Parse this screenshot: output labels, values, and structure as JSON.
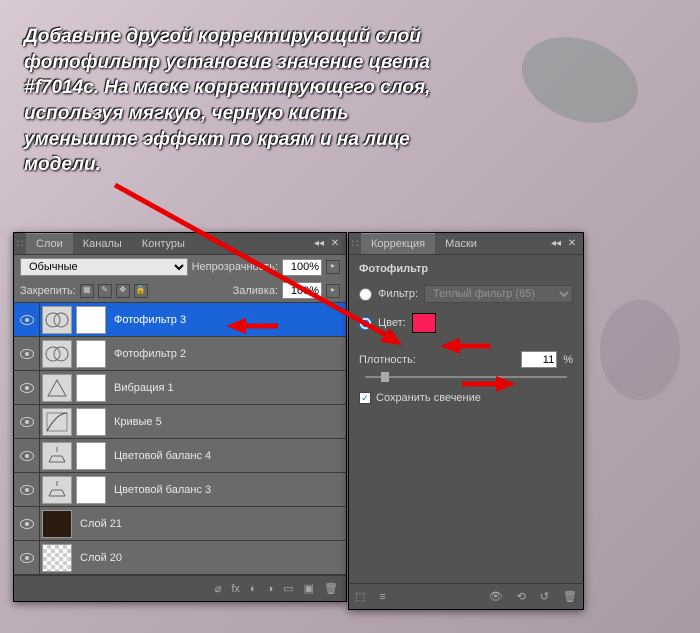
{
  "instruction": "Добавьте другой корректирующий слой фотофильтр установив значение цвета #f7014c. На маске корректирующего слоя, используя мягкую, черную кисть уменьшите эффект по краям и на лице модели.",
  "layers_panel": {
    "tabs": [
      "Слои",
      "Каналы",
      "Контуры"
    ],
    "blend_mode": "Обычные",
    "opacity_label": "Непрозрачность:",
    "opacity_value": "100%",
    "lock_label": "Закрепить:",
    "fill_label": "Заливка:",
    "fill_value": "100%",
    "layers": [
      {
        "name": "Фотофильтр 3",
        "selected": true,
        "type": "adj"
      },
      {
        "name": "Фотофильтр 2",
        "type": "adj"
      },
      {
        "name": "Вибрация 1",
        "type": "adj"
      },
      {
        "name": "Кривые 5",
        "type": "adj"
      },
      {
        "name": "Цветовой баланс 4",
        "type": "adj"
      },
      {
        "name": "Цветовой баланс 3",
        "type": "adj"
      },
      {
        "name": "Слой 21",
        "type": "dark"
      },
      {
        "name": "Слой 20",
        "type": "checker"
      }
    ]
  },
  "correction_panel": {
    "tabs": [
      "Коррекция",
      "Маски"
    ],
    "title": "Фотофильтр",
    "filter_label": "Фильтр:",
    "filter_value": "Теплый фильтр (85)",
    "color_label": "Цвет:",
    "color_value": "#fa1d58",
    "density_label": "Плотность:",
    "density_value": "11",
    "density_unit": "%",
    "preserve_label": "Сохранить свечение"
  }
}
